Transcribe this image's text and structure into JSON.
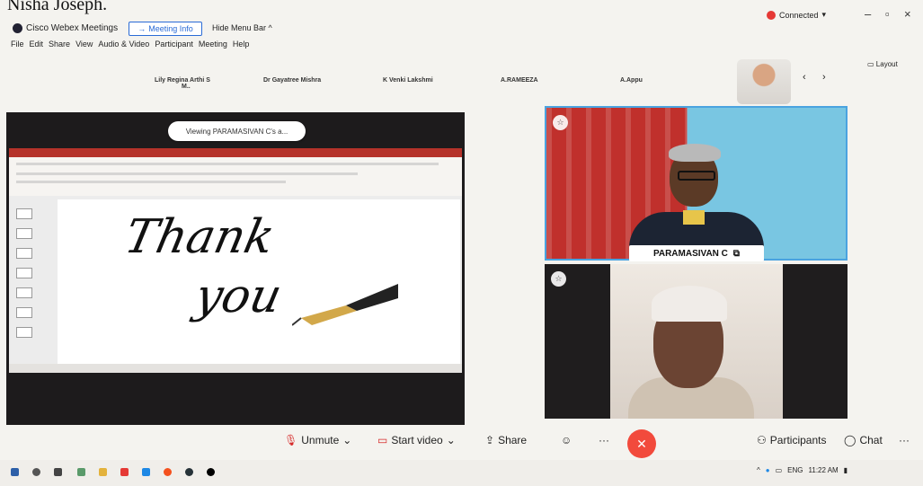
{
  "caption": "Nisha Joseph.",
  "app": {
    "title": "Cisco Webex Meetings",
    "meeting_info": "Meeting Info",
    "hide_menu": "Hide Menu Bar ^",
    "connected": "Connected",
    "layout": "Layout"
  },
  "menu": [
    "File",
    "Edit",
    "Share",
    "View",
    "Audio & Video",
    "Participant",
    "Meeting",
    "Help"
  ],
  "participants_strip": [
    {
      "name": "Lily Regina Arthi S",
      "line2": "M.."
    },
    {
      "name": "Dr Gayatree Mishra"
    },
    {
      "name": "K Venki Lakshmi"
    },
    {
      "name": "A.RAMEEZA"
    },
    {
      "name": "A.Appu"
    }
  ],
  "share": {
    "viewing": "Viewing PARAMASIVAN C's a...",
    "slide_line1": "Thank",
    "slide_line2": "you"
  },
  "tiles": {
    "main_name": "PARAMASIVAN C"
  },
  "controls": {
    "unmute": "Unmute",
    "start_video": "Start video",
    "share": "Share",
    "more": "···",
    "participants": "Participants",
    "chat": "Chat"
  },
  "tray": {
    "lang": "ENG",
    "time": "11:22 AM"
  },
  "colors": {
    "accent": "#2a6bd6",
    "end_call": "#f24a3c",
    "connected": "#e53935"
  }
}
